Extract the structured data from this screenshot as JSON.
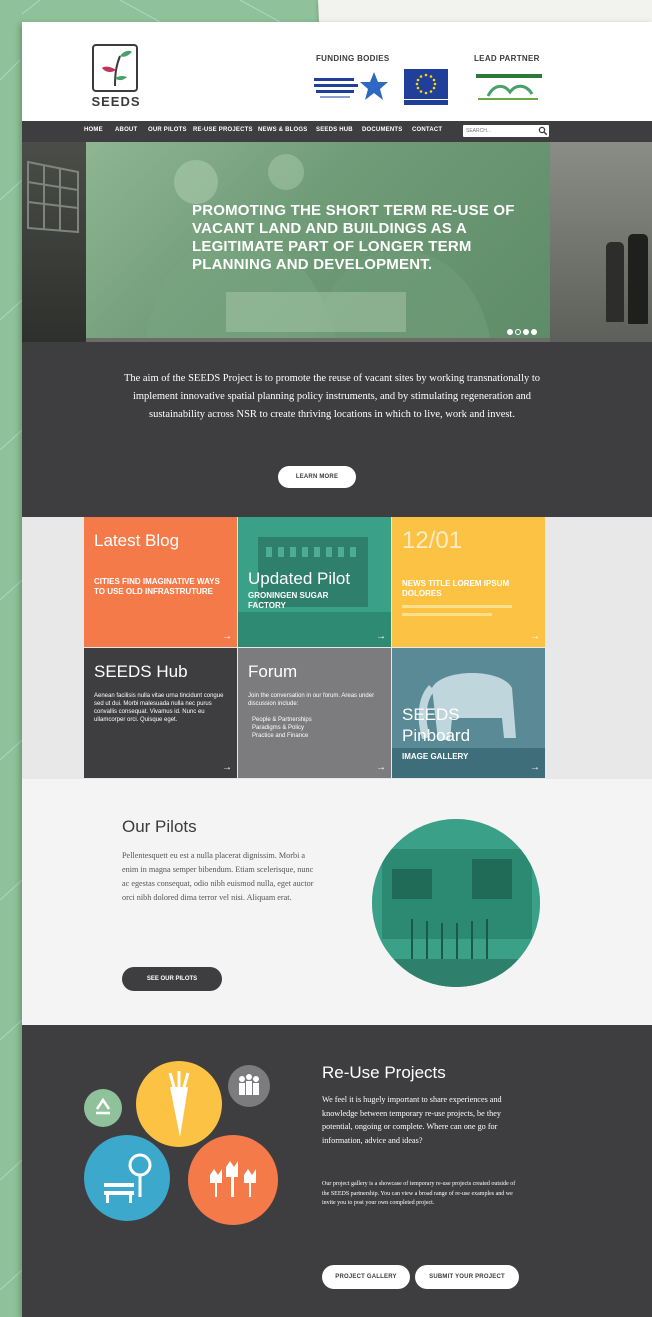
{
  "header": {
    "logo_text": "SEEDS",
    "funding_title": "FUNDING BODIES",
    "lead_title": "LEAD PARTNER"
  },
  "nav": {
    "items": [
      "HOME",
      "ABOUT",
      "OUR PILOTS",
      "RE-USE PROJECTS",
      "NEWS & BLOGS",
      "SEEDS HUB",
      "DOCUMENTS",
      "CONTACT"
    ],
    "search_placeholder": "SEARCH..."
  },
  "hero": {
    "headline": "PROMOTING THE SHORT TERM RE-USE OF VACANT LAND AND BUILDINGS AS A LEGITIMATE PART OF LONGER TERM PLANNING AND DEVELOPMENT."
  },
  "aim": {
    "text": "The aim of the SEEDS Project is to promote the reuse of vacant sites by working transnationally to implement innovative spatial planning policy instruments, and by stimulating regeneration and sustainability across NSR to create thriving locations in which to live, work and invest.",
    "button": "LEARN MORE"
  },
  "tiles": {
    "blog": {
      "title": "Latest Blog",
      "subtitle": "CITIES FIND IMAGINATIVE WAYS TO USE OLD INFRASTRUTURE"
    },
    "pilot": {
      "title": "Updated Pilot",
      "subtitle": "GRONINGEN SUGAR FACTORY"
    },
    "news": {
      "title": "12/01",
      "subtitle": "NEWS TITLE LOREM IPSUM DOLORES"
    },
    "hub": {
      "title": "SEEDS Hub",
      "body": "Aenean facilisis nulla vitae urna tincidunt congue sed ut dui. Morbi malesuada nulla nec purus convallis consequat. Vivamus id. Nunc eu ullamcorper orci. Quisque eget."
    },
    "forum": {
      "title": "Forum",
      "body": "Join the conversation in our forum. Areas under discussion include:",
      "topics": [
        "People & Partnerships",
        "Paradigms & Policy",
        "Practice and Finance"
      ]
    },
    "pinboard": {
      "title": "SEEDS Pinboard",
      "subtitle": "IMAGE GALLERY"
    }
  },
  "pilots": {
    "title": "Our Pilots",
    "text": "Pellentesquett eu est a nulla placerat dignissim. Morbi a enim in magna semper bibendum. Etiam scelerisque, nunc ac egestas consequat, odio nibh euismod nulla, eget auctor orci nibh dolored dima terror vel nisi. Aliquam erat.",
    "button": "SEE OUR PILOTS"
  },
  "reuse": {
    "title": "Re-Use Projects",
    "text": "We feel it is hugely important to share experiences and knowledge between temporary re-use projects, be they potential, ongoing or complete. Where can one go for information, advice and ideas?",
    "small": "Our project gallery is a showcase of temporary re-use projects created outside of the SEEDS partnership. You can view a broad range of re-use examples and we invite you to post your own completed project.",
    "btn_gallery": "PROJECT GALLERY",
    "btn_submit": "SUBMIT YOUR PROJECT"
  },
  "colors": {
    "dark": "#3e3d3f",
    "orange": "#f47a4a",
    "teal": "#3ba088",
    "yellow": "#fcc243",
    "grey": "#7c7b7d",
    "blue": "#3ba8cc",
    "green_bg": "#8fc29a"
  }
}
